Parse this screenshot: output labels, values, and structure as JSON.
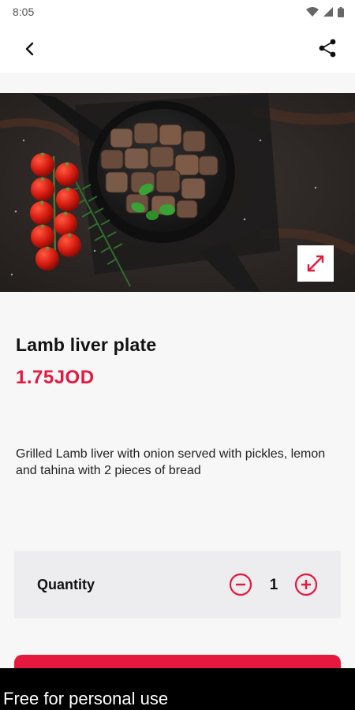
{
  "status_bar": {
    "time": "8:05",
    "icons": [
      "wifi-icon",
      "cell-signal-icon",
      "battery-icon"
    ]
  },
  "app_bar": {
    "icons": [
      "back-arrow-icon",
      "share-icon"
    ]
  },
  "hero": {
    "alt": "Cast iron pan of grilled lamb liver with cherry tomatoes and rosemary",
    "expand_icon": "expand-icon"
  },
  "product": {
    "name": "Lamb liver plate",
    "price": "1.75JOD",
    "description": "Grilled Lamb liver with onion served with pickles, lemon and tahina with 2 pieces of bread"
  },
  "quantity": {
    "label": "Quantity",
    "value": "1",
    "icons": [
      "minus-circle-icon",
      "plus-circle-icon"
    ]
  },
  "watermark": {
    "text": "Free for personal use"
  },
  "colors": {
    "accent": "#e5183e",
    "background": "#f7f7f7",
    "card": "#ededef"
  }
}
